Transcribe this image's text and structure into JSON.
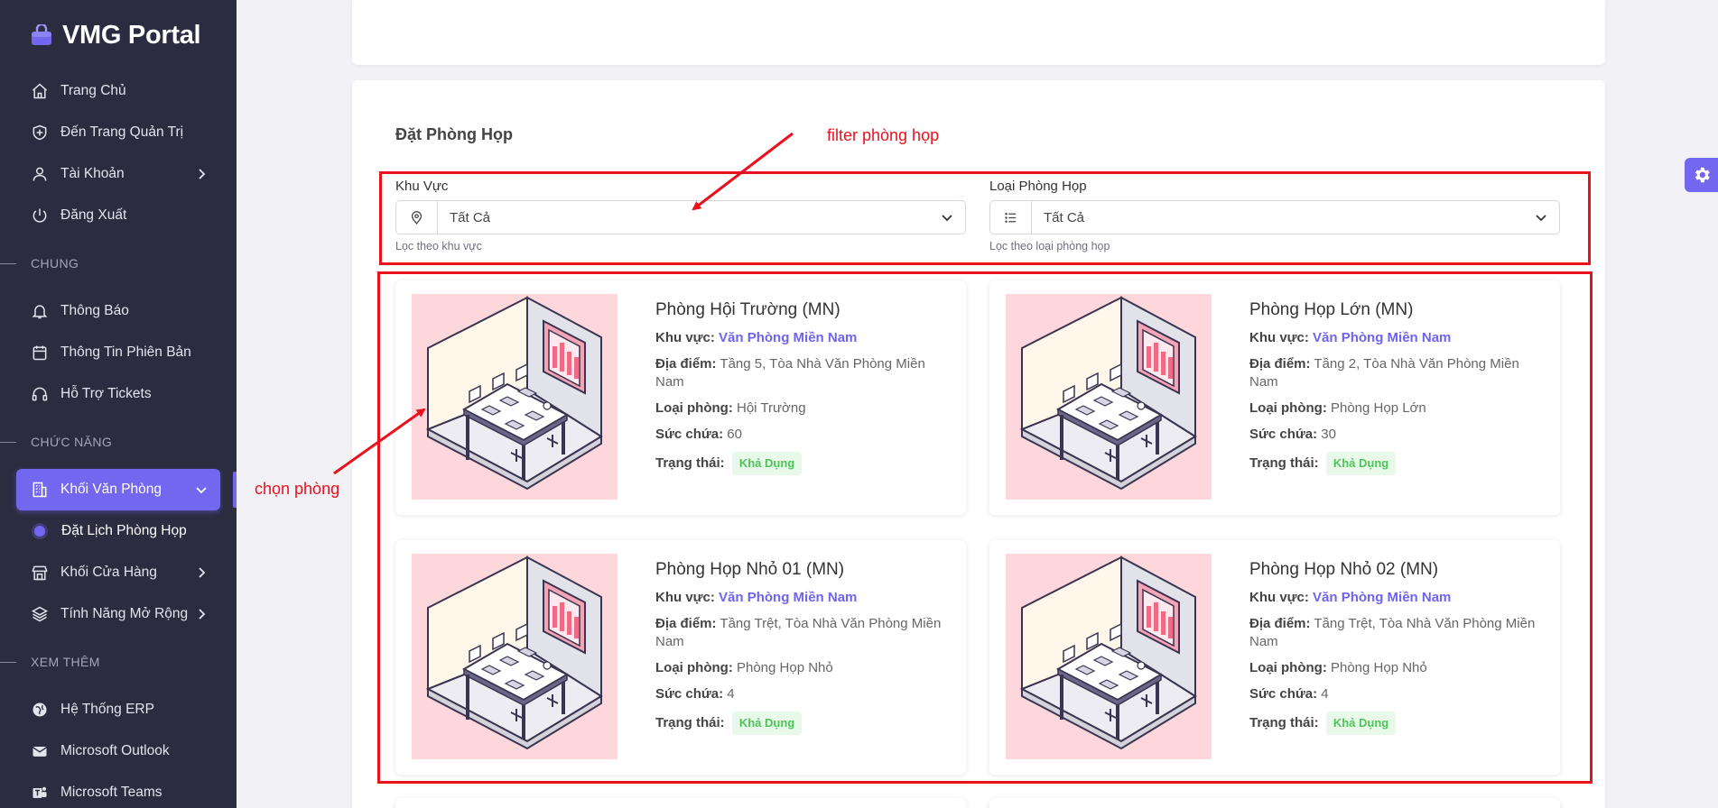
{
  "app": {
    "name": "VMG Portal"
  },
  "sidebar": {
    "top_items": [
      {
        "label": "Trang Chủ",
        "icon": "home-icon"
      },
      {
        "label": "Đến Trang Quản Trị",
        "icon": "shield-icon"
      },
      {
        "label": "Tài Khoản",
        "icon": "user-icon"
      },
      {
        "label": "Đăng Xuất",
        "icon": "power-icon"
      }
    ],
    "section_chung": "CHUNG",
    "chung_items": [
      {
        "label": "Thông Báo",
        "icon": "bell-icon"
      },
      {
        "label": "Thông Tin Phiên Bản",
        "icon": "calendar-icon"
      },
      {
        "label": "Hỗ Trợ Tickets",
        "icon": "headset-icon"
      }
    ],
    "section_chuc_nang": "CHỨC NĂNG",
    "chuc_nang_items": [
      {
        "label": "Khối Văn Phòng",
        "icon": "building-icon"
      },
      {
        "label": "Đặt Lịch Phòng Họp"
      },
      {
        "label": "Khối Cửa Hàng",
        "icon": "store-icon"
      },
      {
        "label": "Tính Năng Mở Rộng",
        "icon": "layers-icon"
      }
    ],
    "section_xem_them": "XEM THÊM",
    "xem_them_items": [
      {
        "label": "Hệ Thống ERP",
        "icon": "globe-icon"
      },
      {
        "label": "Microsoft Outlook",
        "icon": "mail-icon"
      },
      {
        "label": "Microsoft Teams",
        "icon": "teams-icon"
      }
    ]
  },
  "main": {
    "title": "Đặt Phòng Họp",
    "filters": {
      "area": {
        "label": "Khu Vực",
        "value": "Tất Cả",
        "help": "Lọc theo khu vực"
      },
      "type": {
        "label": "Loại Phòng Họp",
        "value": "Tất Cả",
        "help": "Lọc theo loại phòng họp"
      }
    },
    "field_labels": {
      "area": "Khu vực:",
      "location": "Địa điểm:",
      "type": "Loại phòng:",
      "capacity": "Sức chứa:",
      "status": "Trạng thái:"
    },
    "rooms": [
      {
        "name": "Phòng Hội Trường (MN)",
        "area": "Văn Phòng Miền Nam",
        "location": "Tầng 5, Tòa Nhà Văn Phòng Miền Nam",
        "type": "Hội Trường",
        "capacity": "60",
        "status": "Khả Dụng"
      },
      {
        "name": "Phòng Họp Lớn (MN)",
        "area": "Văn Phòng Miền Nam",
        "location": "Tầng 2, Tòa Nhà Văn Phòng Miền Nam",
        "type": "Phòng Họp Lớn",
        "capacity": "30",
        "status": "Khả Dụng"
      },
      {
        "name": "Phòng Họp Nhỏ 01 (MN)",
        "area": "Văn Phòng Miền Nam",
        "location": "Tầng Trệt, Tòa Nhà Văn Phòng Miền Nam",
        "type": "Phòng Họp Nhỏ",
        "capacity": "4",
        "status": "Khả Dụng"
      },
      {
        "name": "Phòng Họp Nhỏ 02 (MN)",
        "area": "Văn Phòng Miền Nam",
        "location": "Tầng Trệt, Tòa Nhà Văn Phòng Miền Nam",
        "type": "Phòng Họp Nhỏ",
        "capacity": "4",
        "status": "Khả Dụng"
      }
    ]
  },
  "annotations": {
    "filter_label": "filter phòng họp",
    "choose_label": "chọn phòng"
  },
  "colors": {
    "accent": "#7367f0",
    "sidebar_bg": "#2b2c40",
    "annotation": "#e8121e",
    "status_ok": "#4fc45a",
    "room_bg": "#fdd7dc"
  }
}
